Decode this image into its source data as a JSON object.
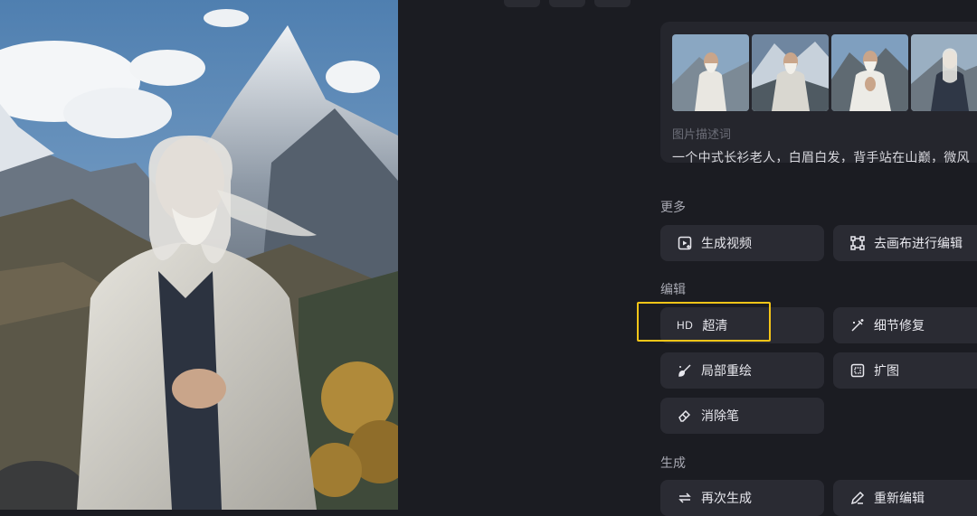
{
  "preview": {
    "image_description": "old-man-in-white-robe-on-mountain"
  },
  "card": {
    "thumbnails": [
      {
        "icon": "thumbnail-1"
      },
      {
        "icon": "thumbnail-2"
      },
      {
        "icon": "thumbnail-3"
      },
      {
        "icon": "thumbnail-4"
      }
    ],
    "prompt_label": "图片描述词",
    "prompt_text": "一个中式长衫老人，白眉白发，背手站在山巅，微风"
  },
  "sections": {
    "more": {
      "title": "更多",
      "buttons": [
        {
          "label": "生成视频",
          "icon": "video-generate-icon"
        },
        {
          "label": "去画布进行编辑",
          "icon": "canvas-edit-icon"
        }
      ]
    },
    "edit": {
      "title": "编辑",
      "buttons": [
        {
          "label": "超清",
          "icon_text": "HD"
        },
        {
          "label": "细节修复",
          "icon": "magic-wand-icon"
        },
        {
          "label": "局部重绘",
          "icon": "brush-icon"
        },
        {
          "label": "扩图",
          "icon": "expand-icon"
        },
        {
          "label": "消除笔",
          "icon": "eraser-icon"
        }
      ]
    },
    "generate": {
      "title": "生成",
      "buttons": [
        {
          "label": "再次生成",
          "icon": "regenerate-icon"
        },
        {
          "label": "重新编辑",
          "icon": "pencil-icon"
        }
      ]
    }
  },
  "colors": {
    "background": "#1b1c22",
    "button": "#2a2b33",
    "highlight": "#f5c518"
  }
}
